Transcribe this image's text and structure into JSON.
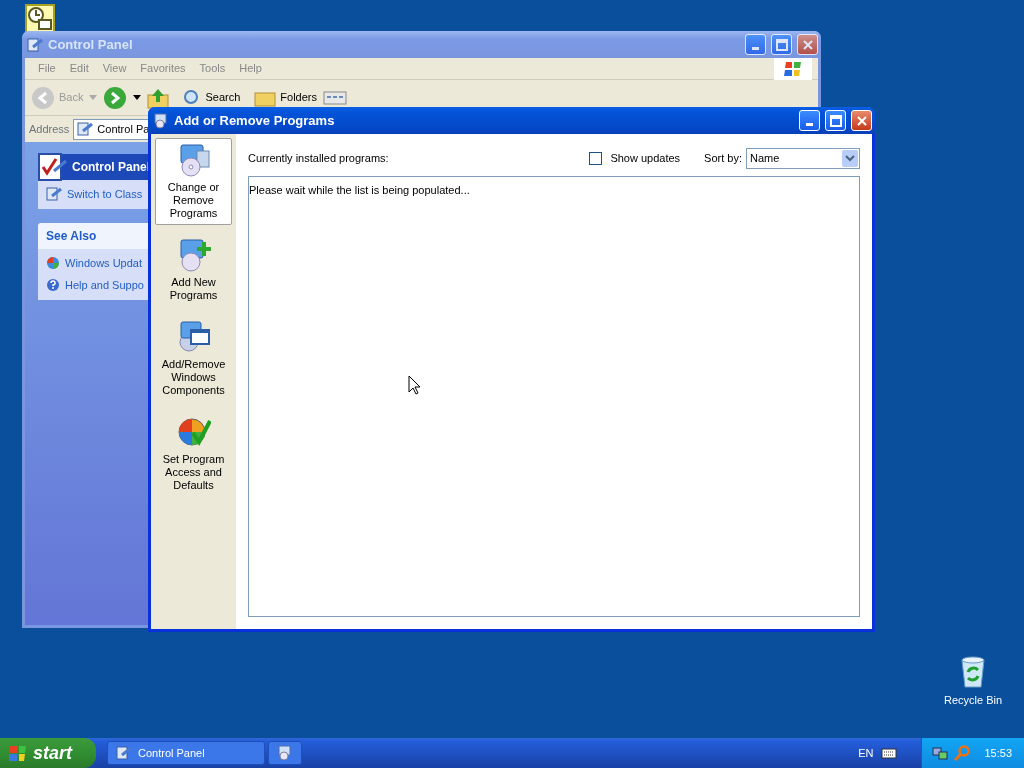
{
  "desktop": {
    "recycle_bin": {
      "label": "Recycle Bin"
    }
  },
  "control_panel": {
    "title": "Control Panel",
    "active": false,
    "menu": [
      "File",
      "Edit",
      "View",
      "Favorites",
      "Tools",
      "Help"
    ],
    "toolbar": {
      "back": "Back",
      "search": "Search",
      "folders": "Folders"
    },
    "address": {
      "label": "Address",
      "value": "Control Pa"
    },
    "tasks": {
      "header": "Control Panel",
      "switch": "Switch to Class"
    },
    "see_also": {
      "header": "See Also",
      "links": [
        "Windows Updat",
        "Help and Suppo"
      ]
    }
  },
  "dialog": {
    "title": "Add or Remove Programs",
    "active": true,
    "sidebar": [
      {
        "label": "Change or Remove Programs",
        "selected": true
      },
      {
        "label": "Add New Programs",
        "selected": false
      },
      {
        "label": "Add/Remove Windows Components",
        "selected": false
      },
      {
        "label": "Set Program Access and Defaults",
        "selected": false
      }
    ],
    "installed_label": "Currently installed programs:",
    "show_updates": {
      "label": "Show updates",
      "checked": false
    },
    "sort_by": {
      "label": "Sort by:",
      "value": "Name"
    },
    "list_message": "Please wait while the list is being populated..."
  },
  "taskbar": {
    "start": "start",
    "tasks": [
      {
        "label": "Control Panel",
        "selected": false
      },
      {
        "selected": false
      }
    ],
    "language": "EN",
    "clock": "15:53"
  }
}
